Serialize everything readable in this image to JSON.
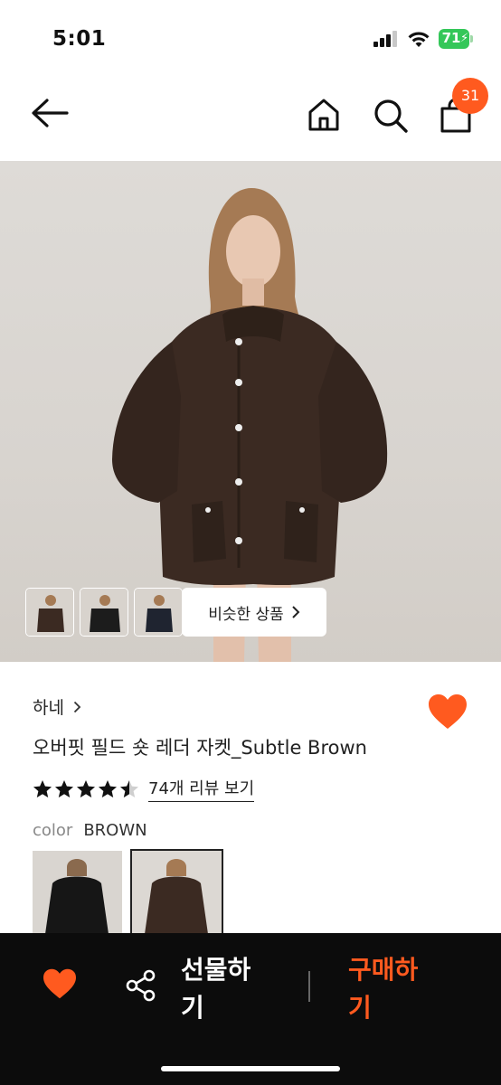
{
  "status": {
    "time": "5:01",
    "battery": "71"
  },
  "nav": {
    "cart_count": "31"
  },
  "hero": {
    "similar_label": "비슷한 상품"
  },
  "product": {
    "brand": "하네",
    "name": "오버핏 필드 숏 레더 자켓_Subtle Brown",
    "rating": 4.5,
    "review_link": "74개 리뷰 보기",
    "color_label": "color",
    "color_value": "BROWN"
  },
  "bottom": {
    "gift_label": "선물하기",
    "buy_label": "구매하기"
  },
  "colors": {
    "accent": "#ff5a1f",
    "battery": "#34c759",
    "bar": "#0c0c0c"
  },
  "icons": [
    "back-arrow-icon",
    "home-icon",
    "search-icon",
    "cart-icon",
    "chevron-right-icon",
    "heart-icon",
    "star-icon",
    "share-icon"
  ]
}
